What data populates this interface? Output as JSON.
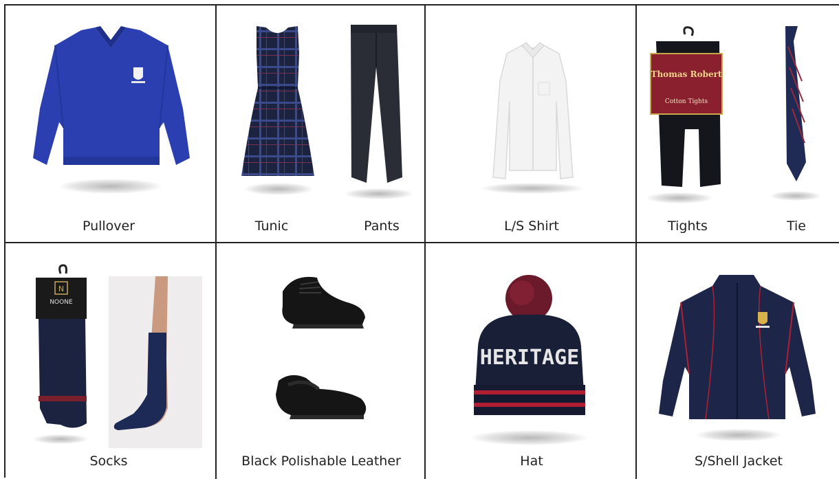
{
  "items": [
    {
      "label": "Pullover"
    },
    {
      "label": "Tunic"
    },
    {
      "label": "Pants"
    },
    {
      "label": "L/S Shirt"
    },
    {
      "label": "Tights"
    },
    {
      "label": "Tie"
    },
    {
      "label": "Socks"
    },
    {
      "label": "Black Polishable Leather"
    },
    {
      "label": "Hat"
    },
    {
      "label": "S/Shell Jacket"
    }
  ],
  "tights_pack": {
    "brand": "Thomas Robert",
    "product": "Cotton Tights"
  },
  "socks_pack": {
    "brand": "NOONE",
    "logo": "N"
  },
  "hat": {
    "text": "HERITAGE"
  },
  "colors": {
    "royal_blue": "#2b3fb0",
    "navy": "#1c2340",
    "maroon": "#7a1f2c",
    "black": "#141414"
  },
  "icons": [
    "crest-emblem-icon",
    "hanger-hook-icon"
  ]
}
